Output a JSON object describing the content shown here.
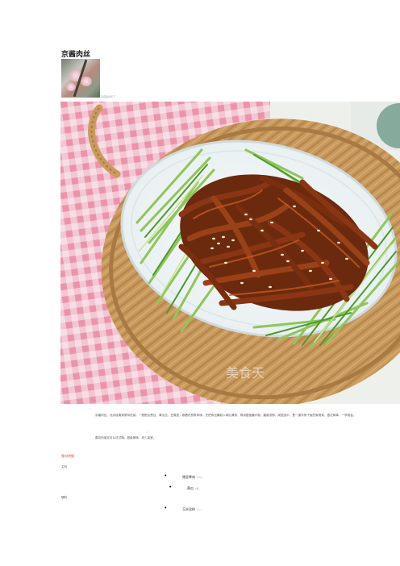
{
  "recipe": {
    "title": "京酱肉丝",
    "author": "来自美食天下"
  },
  "photo": {
    "watermark": "美食天",
    "colors": {
      "tablecloth_base": "#f6dfe4",
      "tablecloth_check": "#ee9bb0",
      "basket": "#c99b5f",
      "basket_dark": "#a87a43",
      "plate": "#eef3f4",
      "plate_rim": "#dbe4e6",
      "cucumber": "#8fc55a",
      "cucumber_dark": "#4f9a2c",
      "pork": "#8a3513",
      "pork_dark": "#5e210a",
      "sesame": "#f4e7cf"
    }
  },
  "description": {
    "quote_open": "“",
    "quote_close": "”",
    "intro": "京酱肉丝，北京经典家常特色菜。一般配合葱丝、黄瓜丝、豆腐皮，卷着吃别有风味。先把肉丝腌制入味后滑熟，再用甜面酱炒制，酱香浓郁，咸甜适中，是一道非常下饭的家常菜，做法简单，一学就会。",
    "closing": "喜欢的朋友可以试试哦，超级美味，老少皆宜。"
  },
  "ingredients": {
    "heading": "食材明细",
    "groups": [
      {
        "label": "主料",
        "items": [
          {
            "name": "猪里脊肉",
            "amount": "300g"
          },
          {
            "name": "黄瓜",
            "amount": "1根"
          }
        ]
      },
      {
        "label": "辅料",
        "items": [
          {
            "name": "玉米淀粉",
            "amount": "1勺"
          }
        ]
      }
    ]
  }
}
